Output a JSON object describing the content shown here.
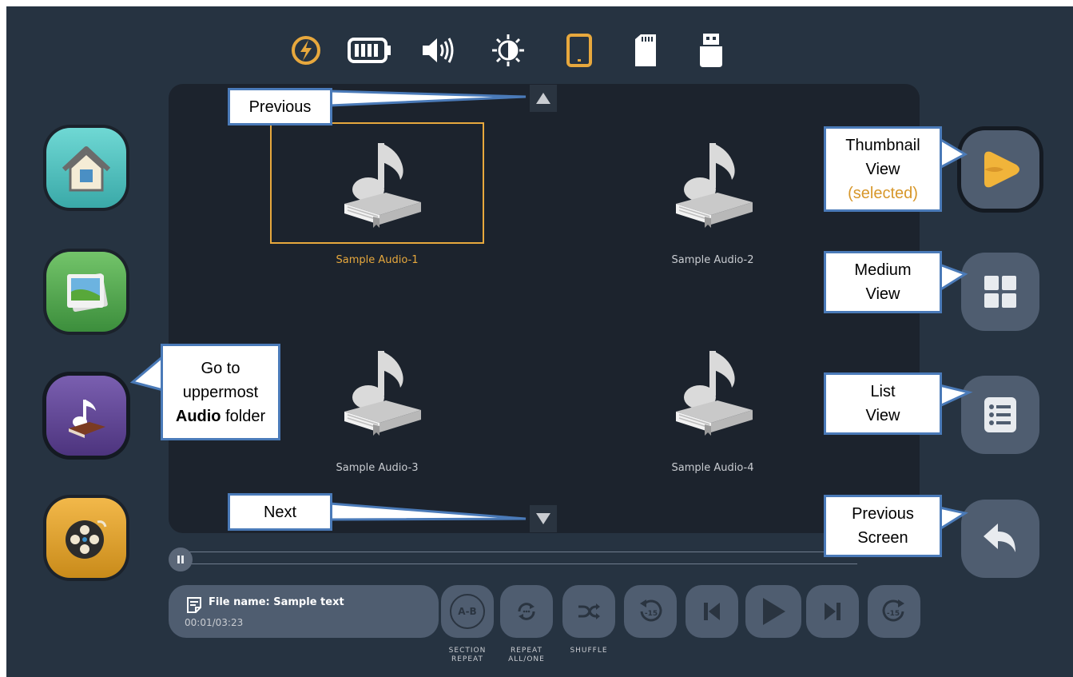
{
  "colors": {
    "accent": "#e7a83d",
    "panel": "#1c232d",
    "background": "#263341",
    "button": "#4f5d70",
    "callout_border": "#4a7ab8"
  },
  "status_bar": {
    "icons": [
      "charging-icon",
      "battery-icon",
      "volume-icon",
      "brightness-icon",
      "tablet-icon",
      "sd-card-icon",
      "usb-icon"
    ]
  },
  "thumbnails": [
    {
      "label": "Sample Audio-1",
      "selected": true
    },
    {
      "label": "Sample Audio-2",
      "selected": false
    },
    {
      "label": "Sample Audio-3",
      "selected": false
    },
    {
      "label": "Sample Audio-4",
      "selected": false
    }
  ],
  "player": {
    "file_name": "File name: Sample text",
    "time": "00:01/03:23",
    "controls": [
      {
        "name": "section-repeat",
        "label_line1": "SECTION",
        "label_line2": "REPEAT",
        "icon_text": "A-B"
      },
      {
        "name": "repeat",
        "label_line1": "REPEAT",
        "label_line2": "ALL/ONE"
      },
      {
        "name": "shuffle",
        "label_line1": "SHUFFLE",
        "label_line2": ""
      },
      {
        "name": "rewind-15",
        "icon_text": "-15"
      },
      {
        "name": "previous-track"
      },
      {
        "name": "play"
      },
      {
        "name": "next-track"
      },
      {
        "name": "forward-15",
        "icon_text": "-15"
      }
    ]
  },
  "callouts": {
    "previous": "Previous",
    "next": "Next",
    "thumbnail_view_1": "Thumbnail",
    "thumbnail_view_2": "View",
    "thumbnail_view_selected": "(selected)",
    "medium_view_1": "Medium",
    "medium_view_2": "View",
    "list_view_1": "List",
    "list_view_2": "View",
    "previous_screen_1": "Previous",
    "previous_screen_2": "Screen",
    "audio_folder_1": "Go to",
    "audio_folder_2": "uppermost",
    "audio_folder_bold": "Audio",
    "audio_folder_3": "folder"
  }
}
